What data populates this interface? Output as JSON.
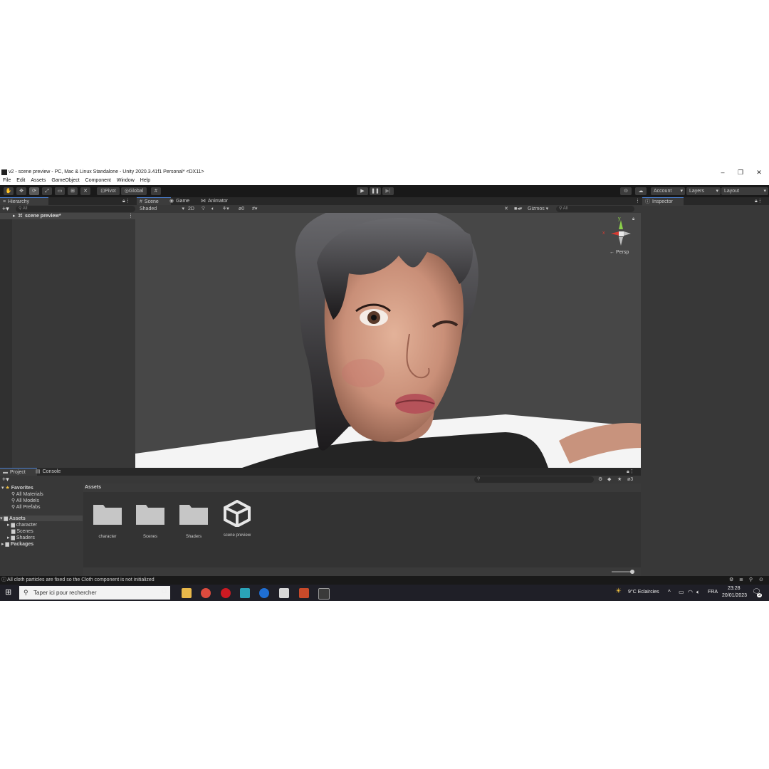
{
  "window": {
    "title": "v2 - scene preview - PC, Mac & Linux Standalone - Unity 2020.3.41f1 Personal* <DX11>",
    "minimize": "–",
    "restore": "❐",
    "close": "✕"
  },
  "menu": [
    "File",
    "Edit",
    "Assets",
    "GameObject",
    "Component",
    "Window",
    "Help"
  ],
  "toolbar": {
    "pivot": "Pivot",
    "global": "Global",
    "account": "Account",
    "layers": "Layers",
    "layout": "Layout"
  },
  "hierarchy": {
    "tab": "Hierarchy",
    "search_placeholder": "All",
    "item": "scene preview*"
  },
  "scene": {
    "tabs": [
      "Scene",
      "Game",
      "Animator"
    ],
    "shading": "Shaded",
    "mode_2d": "2D",
    "gizmos": "Gizmos",
    "search_placeholder": "All",
    "fx_count": "0",
    "persp": "← Persp",
    "axis_y": "y",
    "axis_x": "x"
  },
  "inspector": {
    "tab": "Inspector"
  },
  "project": {
    "tabs": [
      "Project",
      "Console"
    ],
    "favorites": "Favorites",
    "favorite_items": [
      "All Materials",
      "All Models",
      "All Prefabs"
    ],
    "assets_root": "Assets",
    "asset_folders": [
      "character",
      "Scenes",
      "Shaders"
    ],
    "packages": "Packages",
    "breadcrumb": "Assets",
    "hidden_count": "3",
    "items": [
      "character",
      "Scenes",
      "Shaders",
      "scene preview"
    ]
  },
  "status": {
    "message": "All cloth particles are fixed so the Cloth component is not initialized"
  },
  "taskbar": {
    "search_placeholder": "Taper ici pour rechercher",
    "weather": "9°C  Eclaircies",
    "language": "FRA",
    "time": "23:28",
    "date": "20/01/2023",
    "notifications": "3"
  }
}
